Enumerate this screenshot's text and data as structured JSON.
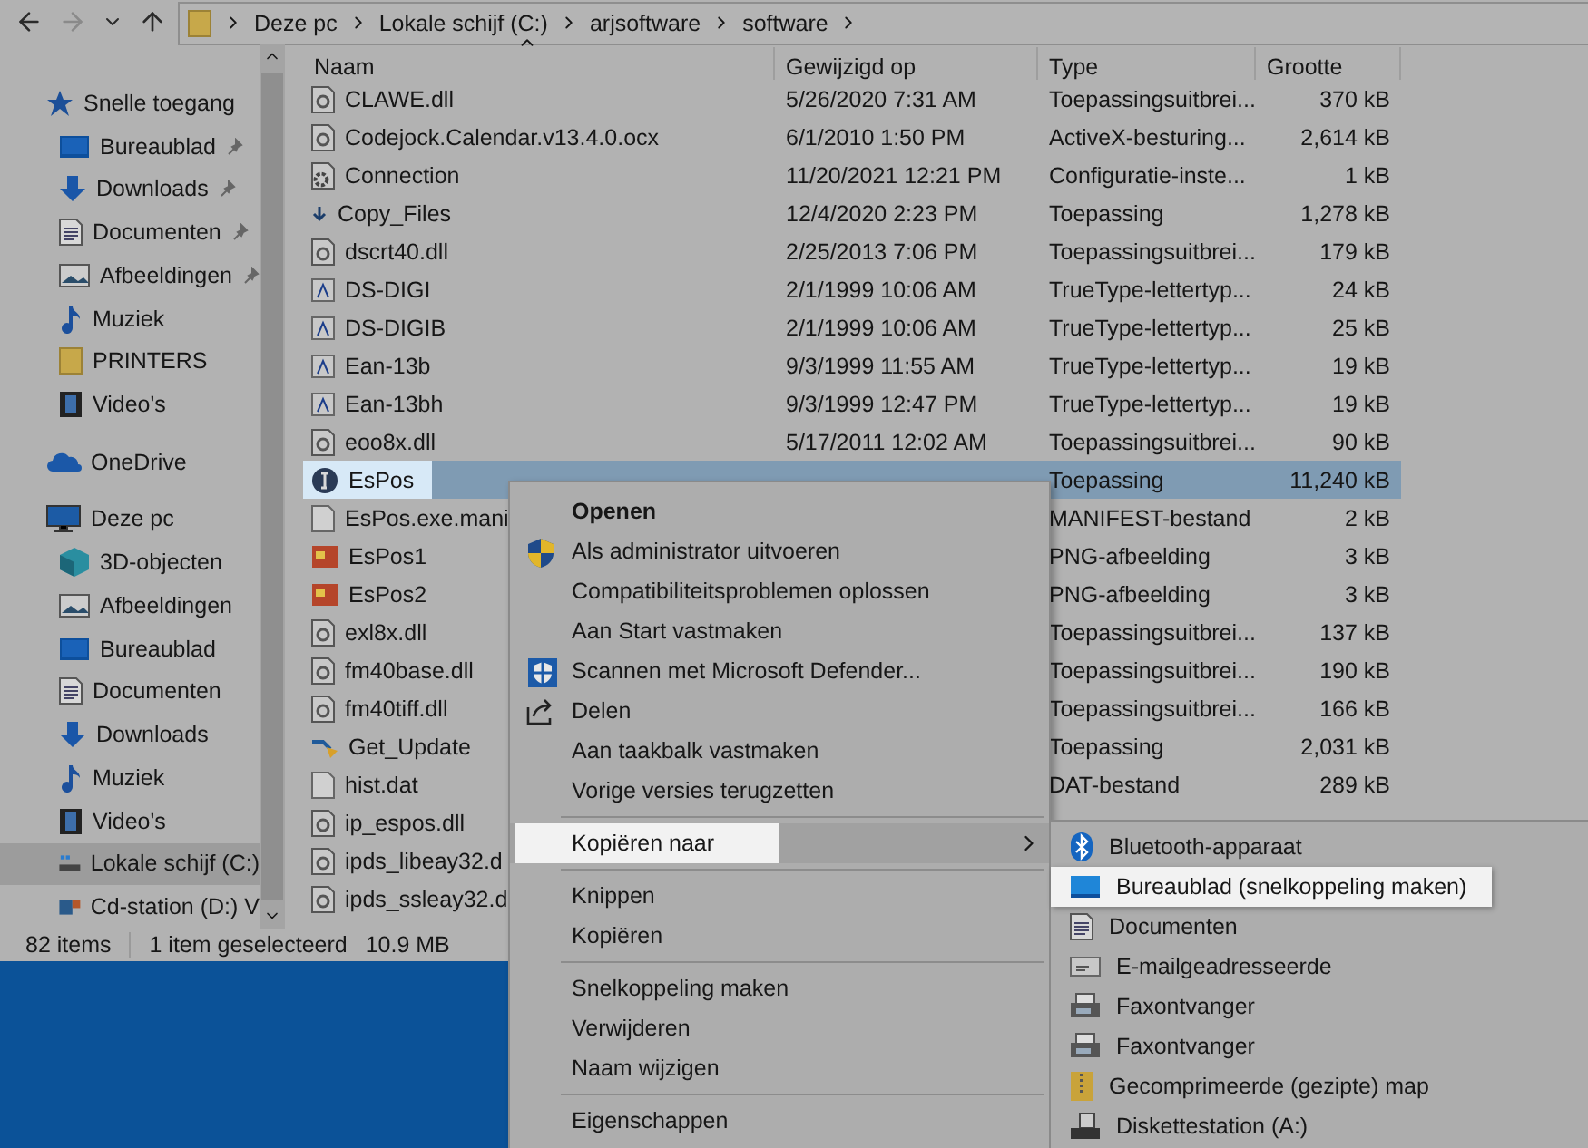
{
  "nav": {
    "back_disabled": false,
    "forward_disabled": true
  },
  "address_bar": {
    "path": [
      "Deze pc",
      "Lokale schijf (C:)",
      "arjsoftware",
      "software"
    ]
  },
  "sidebar": {
    "items": [
      {
        "label": "Snelle toegang",
        "kind": "star",
        "selected": false,
        "children": [
          {
            "label": "Bureaublad",
            "kind": "desktop",
            "pinned": true,
            "selected": false
          },
          {
            "label": "Downloads",
            "kind": "download",
            "pinned": true,
            "selected": false
          },
          {
            "label": "Documenten",
            "kind": "document",
            "pinned": true,
            "selected": false
          },
          {
            "label": "Afbeeldingen",
            "kind": "pictures",
            "pinned": true,
            "selected": false
          },
          {
            "label": "Muziek",
            "kind": "music",
            "pinned": false,
            "selected": false
          },
          {
            "label": "PRINTERS",
            "kind": "folder",
            "pinned": false,
            "selected": false
          },
          {
            "label": "Video's",
            "kind": "video",
            "pinned": false,
            "selected": false
          }
        ]
      },
      {
        "label": "OneDrive",
        "kind": "cloud",
        "selected": false
      },
      {
        "label": "Deze pc",
        "kind": "pc",
        "selected": false,
        "children": [
          {
            "label": "3D-objecten",
            "kind": "cube",
            "selected": false
          },
          {
            "label": "Afbeeldingen",
            "kind": "pictures",
            "selected": false
          },
          {
            "label": "Bureaublad",
            "kind": "desktop",
            "selected": false
          },
          {
            "label": "Documenten",
            "kind": "document",
            "selected": false
          },
          {
            "label": "Downloads",
            "kind": "download",
            "selected": false
          },
          {
            "label": "Muziek",
            "kind": "music",
            "selected": false
          },
          {
            "label": "Video's",
            "kind": "video",
            "selected": false
          },
          {
            "label": "Lokale schijf (C:)",
            "kind": "drive",
            "selected": true
          },
          {
            "label": "Cd-station (D:) V",
            "kind": "cdrom",
            "selected": false
          }
        ]
      }
    ]
  },
  "file_list": {
    "columns": [
      "Naam",
      "Gewijzigd op",
      "Type",
      "Grootte"
    ],
    "rows": [
      {
        "name": "CLAWE.dll",
        "modified": "5/26/2020 7:31 AM",
        "type": "Toepassingsuitbrei...",
        "size": "370 kB",
        "kind": "dll",
        "selected": false
      },
      {
        "name": "Codejock.Calendar.v13.4.0.ocx",
        "modified": "6/1/2010 1:50 PM",
        "type": "ActiveX-besturing...",
        "size": "2,614 kB",
        "kind": "dll",
        "selected": false
      },
      {
        "name": "Connection",
        "modified": "11/20/2021 12:21 PM",
        "type": "Configuratie-inste...",
        "size": "1 kB",
        "kind": "config",
        "selected": false
      },
      {
        "name": "Copy_Files",
        "modified": "12/4/2020 2:23 PM",
        "type": "Toepassing",
        "size": "1,278 kB",
        "kind": "arrow",
        "selected": false
      },
      {
        "name": "dscrt40.dll",
        "modified": "2/25/2013 7:06 PM",
        "type": "Toepassingsuitbrei...",
        "size": "179 kB",
        "kind": "dll",
        "selected": false
      },
      {
        "name": "DS-DIGI",
        "modified": "2/1/1999 10:06 AM",
        "type": "TrueType-lettertyp...",
        "size": "24 kB",
        "kind": "font",
        "selected": false
      },
      {
        "name": "DS-DIGIB",
        "modified": "2/1/1999 10:06 AM",
        "type": "TrueType-lettertyp...",
        "size": "25 kB",
        "kind": "font",
        "selected": false
      },
      {
        "name": "Ean-13b",
        "modified": "9/3/1999 11:55 AM",
        "type": "TrueType-lettertyp...",
        "size": "19 kB",
        "kind": "font",
        "selected": false
      },
      {
        "name": "Ean-13bh",
        "modified": "9/3/1999 12:47 PM",
        "type": "TrueType-lettertyp...",
        "size": "19 kB",
        "kind": "font",
        "selected": false
      },
      {
        "name": "eoo8x.dll",
        "modified": "5/17/2011 12:02 AM",
        "type": "Toepassingsuitbrei...",
        "size": "90 kB",
        "kind": "dll",
        "selected": false
      },
      {
        "name": "EsPos",
        "type": "Toepassing",
        "size": "11,240 kB",
        "kind": "app",
        "selected": true
      },
      {
        "name": "EsPos.exe.mani",
        "type": "MANIFEST-bestand",
        "size": "2 kB",
        "kind": "blank",
        "selected": false
      },
      {
        "name": "EsPos1",
        "type": "PNG-afbeelding",
        "size": "3 kB",
        "kind": "image",
        "selected": false
      },
      {
        "name": "EsPos2",
        "type": "PNG-afbeelding",
        "size": "3 kB",
        "kind": "image",
        "selected": false
      },
      {
        "name": "exl8x.dll",
        "type": "Toepassingsuitbrei...",
        "size": "137 kB",
        "kind": "dll",
        "selected": false
      },
      {
        "name": "fm40base.dll",
        "type": "Toepassingsuitbrei...",
        "size": "190 kB",
        "kind": "dll",
        "selected": false
      },
      {
        "name": "fm40tiff.dll",
        "type": "Toepassingsuitbrei...",
        "size": "166 kB",
        "kind": "dll",
        "selected": false
      },
      {
        "name": "Get_Update",
        "type": "Toepassing",
        "size": "2,031 kB",
        "kind": "update",
        "selected": false
      },
      {
        "name": "hist.dat",
        "type": "DAT-bestand",
        "size": "289 kB",
        "kind": "blank",
        "selected": false
      },
      {
        "name": "ip_espos.dll",
        "kind": "dll",
        "selected": false
      },
      {
        "name": "ipds_libeay32.d",
        "kind": "dll",
        "selected": false
      },
      {
        "name": "ipds_ssleay32.d",
        "kind": "dll",
        "selected": false
      }
    ]
  },
  "status_bar": {
    "count": "82 items",
    "selection": "1 item geselecteerd",
    "size": "10.9 MB"
  },
  "context_menu": {
    "items": [
      {
        "kind": "item",
        "label": "Openen",
        "default": true,
        "selected": false
      },
      {
        "kind": "item",
        "label": "Als administrator uitvoeren",
        "default": false,
        "selected": false
      },
      {
        "kind": "item",
        "label": "Compatibiliteitsproblemen oplossen",
        "default": false,
        "selected": false
      },
      {
        "kind": "item",
        "label": "Aan Start vastmaken",
        "default": false,
        "selected": false
      },
      {
        "kind": "item",
        "label": "Scannen met Microsoft Defender...",
        "default": false,
        "selected": false
      },
      {
        "kind": "item",
        "label": "Delen",
        "default": false,
        "selected": false
      },
      {
        "kind": "item",
        "label": "Aan taakbalk vastmaken",
        "default": false,
        "selected": false
      },
      {
        "kind": "item",
        "label": "Vorige versies terugzetten",
        "default": false,
        "selected": false
      },
      {
        "kind": "separator"
      },
      {
        "kind": "submenu",
        "label": "Kopiëren naar",
        "default": false,
        "selected": true
      },
      {
        "kind": "separator"
      },
      {
        "kind": "item",
        "label": "Knippen",
        "default": false,
        "selected": false
      },
      {
        "kind": "item",
        "label": "Kopiëren",
        "default": false,
        "selected": false
      },
      {
        "kind": "separator"
      },
      {
        "kind": "item",
        "label": "Snelkoppeling maken",
        "default": false,
        "selected": false
      },
      {
        "kind": "item",
        "label": "Verwijderen",
        "default": false,
        "selected": false
      },
      {
        "kind": "item",
        "label": "Naam wijzigen",
        "default": false,
        "selected": false
      },
      {
        "kind": "separator"
      },
      {
        "kind": "item",
        "label": "Eigenschappen",
        "default": false,
        "selected": false
      }
    ]
  },
  "submenu": {
    "items": [
      {
        "label": "Bluetooth-apparaat",
        "selected": false
      },
      {
        "label": "Bureaublad (snelkoppeling maken)",
        "selected": true
      },
      {
        "label": "Documenten",
        "selected": false
      },
      {
        "label": "E-mailgeadresseerde",
        "selected": false
      },
      {
        "label": "Faxontvanger",
        "selected": false
      },
      {
        "label": "Faxontvanger",
        "selected": false
      },
      {
        "label": "Gecomprimeerde (gezipte) map",
        "selected": false
      },
      {
        "label": "Diskettestation (A:)",
        "selected": false
      }
    ]
  }
}
